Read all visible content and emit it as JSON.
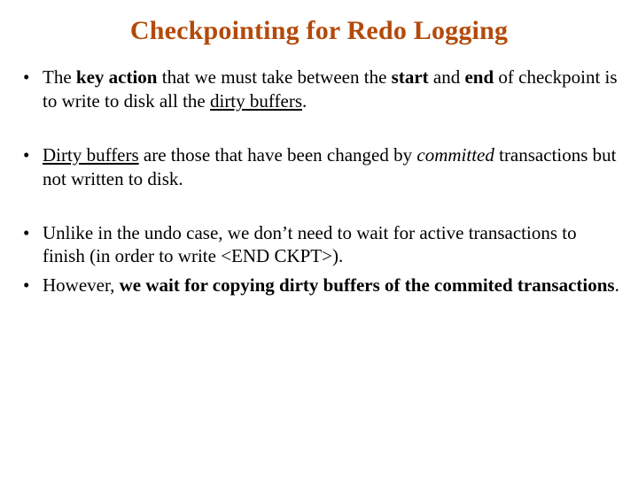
{
  "title": "Checkpointing for Redo Logging",
  "b1": {
    "t1": "The ",
    "t2": "key action",
    "t3": " that we must take between the ",
    "t4": "start",
    "t5": " and ",
    "t6": "end",
    "t7": " of checkpoint is to write to disk all the ",
    "t8": "dirty buffers",
    "t9": "."
  },
  "b2": {
    "t1": "Dirty buffers",
    "t2": " are those that have been changed by ",
    "t3": "committed",
    "t4": " transactions but not written to disk."
  },
  "b3": {
    "t1": "Unlike in the undo case, we don’t need to wait for active transactions to finish (in order to write <END CKPT>)."
  },
  "b4": {
    "t1": "However, ",
    "t2": "we wait for copying dirty buffers of the commited transactions",
    "t3": "."
  }
}
